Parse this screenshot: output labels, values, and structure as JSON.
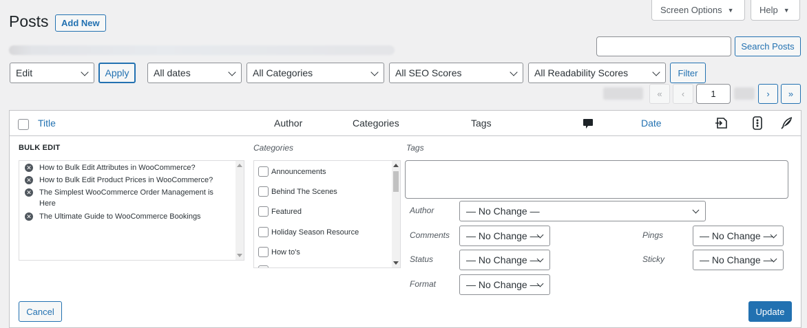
{
  "header": {
    "title": "Posts",
    "add_new": "Add New",
    "screen_options": "Screen Options",
    "help": "Help"
  },
  "search": {
    "value": "",
    "button": "Search Posts"
  },
  "filters": {
    "bulk_action": "Edit",
    "apply": "Apply",
    "dates": "All dates",
    "categories": "All Categories",
    "seo_scores": "All SEO Scores",
    "readability_scores": "All Readability Scores",
    "filter_button": "Filter"
  },
  "pagination": {
    "first": "«",
    "prev": "‹",
    "current_page": "1",
    "next": "›",
    "last": "»"
  },
  "table": {
    "columns": {
      "title": "Title",
      "author": "Author",
      "categories": "Categories",
      "tags": "Tags",
      "date": "Date"
    },
    "icons": [
      "comment-icon",
      "seo-icon",
      "readability-icon",
      "feather-icon"
    ]
  },
  "bulk_edit": {
    "heading": "BULK EDIT",
    "posts": [
      "How to Bulk Edit Attributes in WooCommerce?",
      "How to Bulk Edit Product Prices in WooCommerce?",
      "The Simplest WooCommerce Order Management is Here",
      "The Ultimate Guide to WooCommerce Bookings"
    ],
    "categories_label": "Categories",
    "categories": [
      "Announcements",
      "Behind The Scenes",
      "Featured",
      "Holiday Season Resource",
      "How to's"
    ],
    "tags_label": "Tags",
    "tags_value": "",
    "author_label": "Author",
    "author_value": "— No Change —",
    "comments_label": "Comments",
    "comments_value": "— No Change —",
    "status_label": "Status",
    "status_value": "— No Change —",
    "format_label": "Format",
    "format_value": "— No Change —",
    "pings_label": "Pings",
    "pings_value": "— No Change —",
    "sticky_label": "Sticky",
    "sticky_value": "— No Change —",
    "cancel": "Cancel",
    "update": "Update"
  },
  "colors": {
    "accent": "#2271b1",
    "background": "#f0f0f1"
  }
}
